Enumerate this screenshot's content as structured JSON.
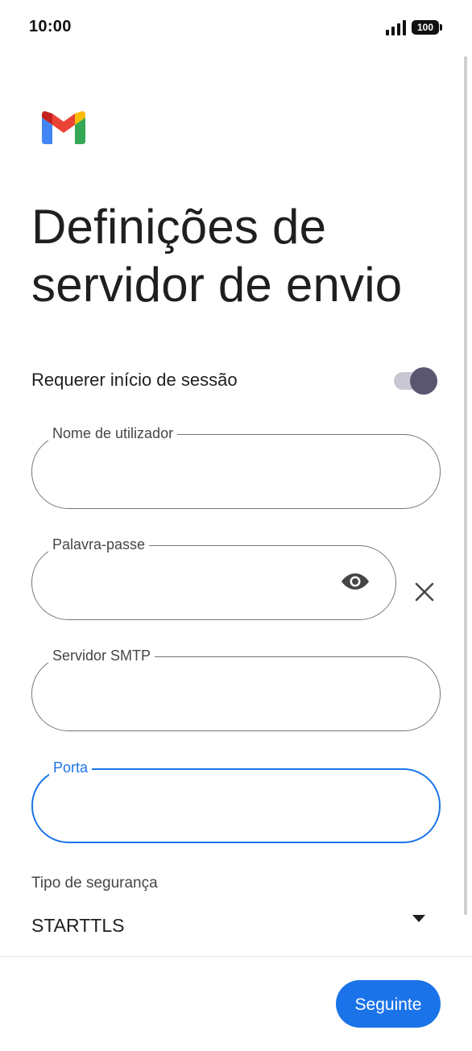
{
  "status_bar": {
    "time": "10:00",
    "battery": "100",
    "icons": [
      "signal-icon",
      "battery-icon"
    ]
  },
  "header": {
    "logo": "gmail-logo",
    "title_line1": "Definições de",
    "title_line2": "servidor de envio"
  },
  "require_signin": {
    "label": "Requerer início de sessão",
    "enabled": true
  },
  "fields": {
    "username": {
      "label": "Nome de utilizador",
      "value": ""
    },
    "password": {
      "label": "Palavra-passe",
      "value": "",
      "icons": [
        "eye-icon",
        "close-icon"
      ]
    },
    "smtp_server": {
      "label": "Servidor SMTP",
      "value": ""
    },
    "port": {
      "label": "Porta",
      "value": "",
      "focused": true
    }
  },
  "security": {
    "label": "Tipo de segurança",
    "value": "STARTTLS",
    "icon": "dropdown-arrow-icon"
  },
  "footer": {
    "next_label": "Seguinte"
  },
  "colors": {
    "accent": "#1a73e8",
    "outline": "#747775",
    "toggle_knob": "#5b5670",
    "toggle_track": "#c9c7d3"
  }
}
